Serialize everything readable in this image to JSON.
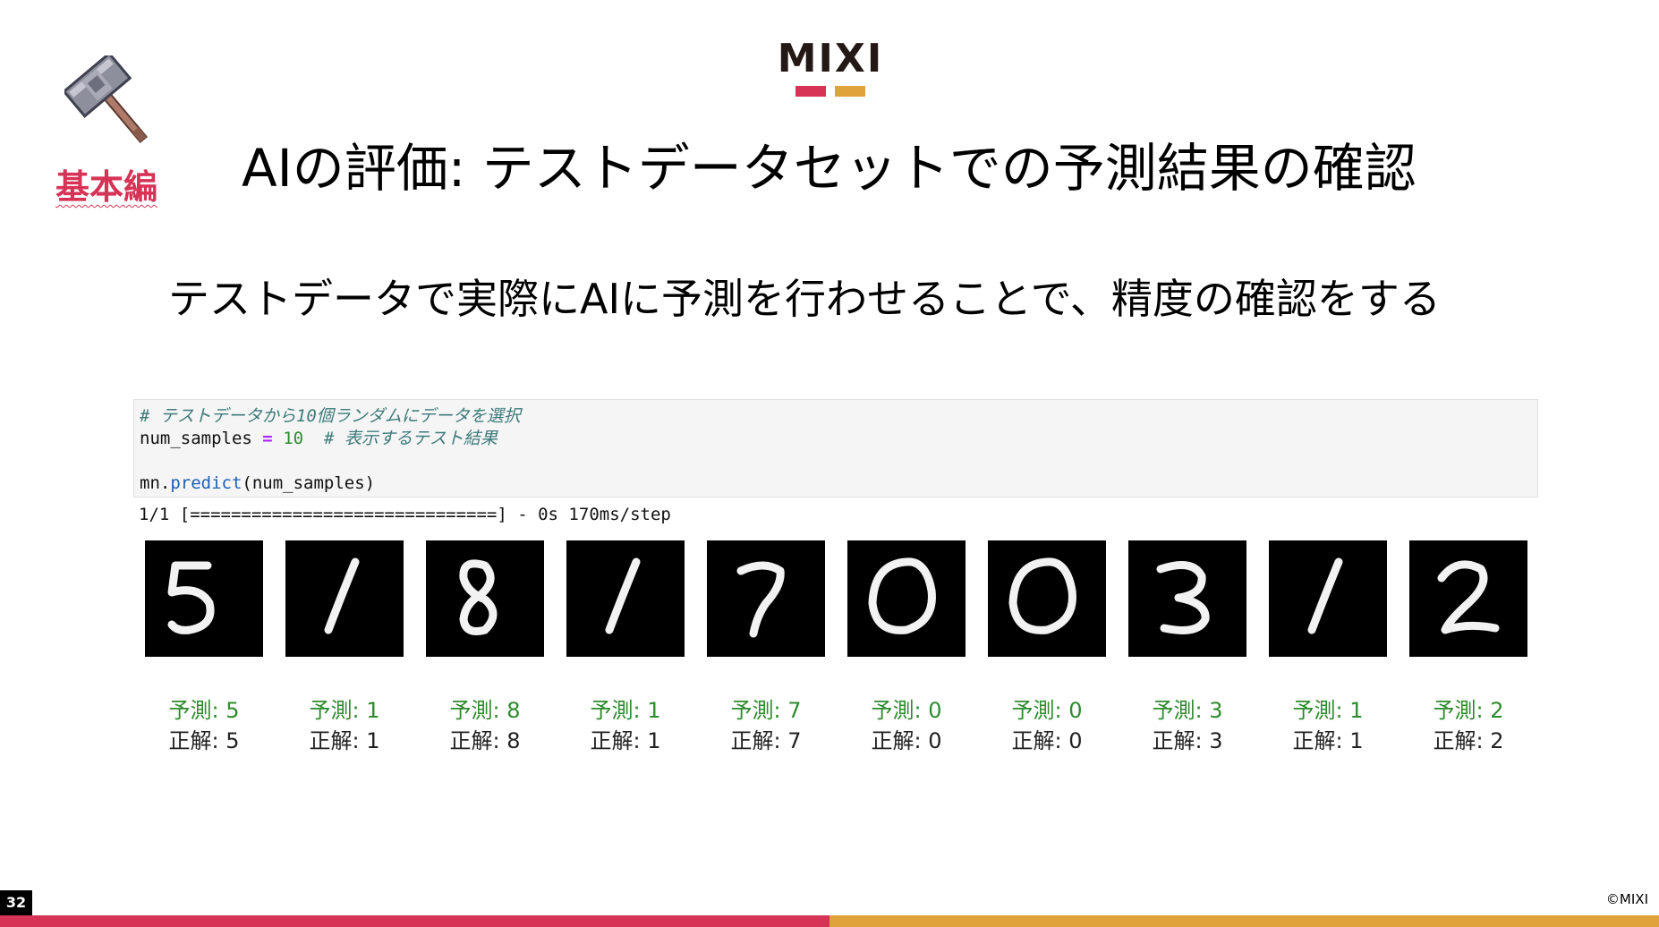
{
  "slide": {
    "logo_text": "MIXI",
    "level_tag": "基本編",
    "title": "AIの評価: テストデータセットでの予測結果の確認",
    "subtitle": "テストデータで実際にAIに予測を行わせることで、精度の確認をする",
    "page_number": "32",
    "copyright": "©MIXI"
  },
  "code_cell": {
    "line1_comment": "# テストデータから10個ランダムにデータを選択",
    "line2_var": "num_samples",
    "line2_op": "=",
    "line2_num": "10",
    "line2_comment": "# 表示するテスト結果",
    "line4_obj": "mn.",
    "line4_fn": "predict",
    "line4_args": "(num_samples)"
  },
  "output_text": "1/1 [==============================] - 0s 170ms/step",
  "results": [
    {
      "digit": "5",
      "pred": "予測: 5",
      "truth": "正解: 5"
    },
    {
      "digit": "1",
      "pred": "予測: 1",
      "truth": "正解: 1"
    },
    {
      "digit": "8",
      "pred": "予測: 8",
      "truth": "正解: 8"
    },
    {
      "digit": "1",
      "pred": "予測: 1",
      "truth": "正解: 1"
    },
    {
      "digit": "7",
      "pred": "予測: 7",
      "truth": "正解: 7"
    },
    {
      "digit": "0",
      "pred": "予測: 0",
      "truth": "正解: 0"
    },
    {
      "digit": "0",
      "pred": "予測: 0",
      "truth": "正解: 0"
    },
    {
      "digit": "3",
      "pred": "予測: 3",
      "truth": "正解: 3"
    },
    {
      "digit": "1",
      "pred": "予測: 1",
      "truth": "正解: 1"
    },
    {
      "digit": "2",
      "pred": "予測: 2",
      "truth": "正解: 2"
    }
  ],
  "colors": {
    "brand_red": "#d63357",
    "brand_yellow": "#e0a33c",
    "level_tag": "#d63357",
    "prediction_text": "#2e8b2e"
  }
}
